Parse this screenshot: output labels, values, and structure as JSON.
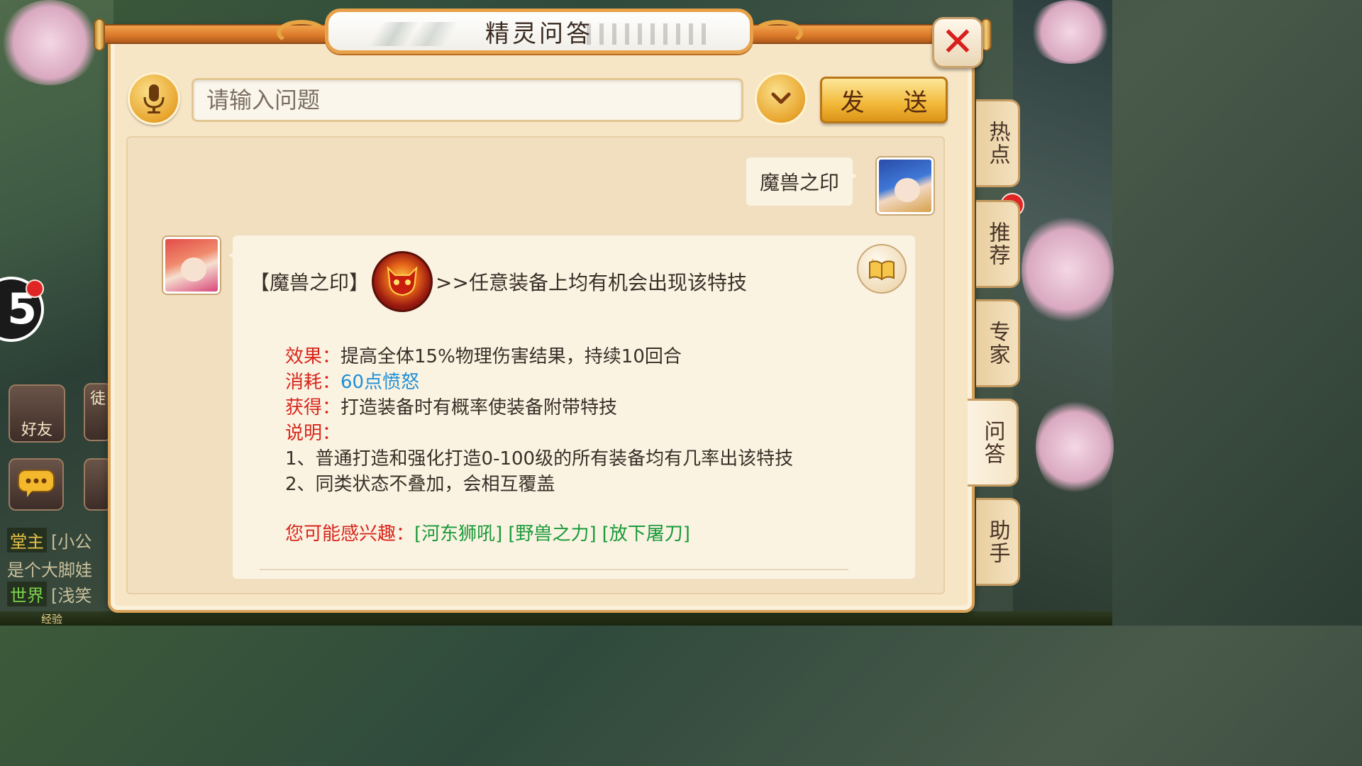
{
  "dialog": {
    "title": "精灵问答"
  },
  "input": {
    "placeholder": "请输入问题"
  },
  "buttons": {
    "send": "发 送"
  },
  "tabs": [
    {
      "label": "热点",
      "has_badge": true
    },
    {
      "label": "推荐"
    },
    {
      "label": "专家"
    },
    {
      "label": "问答",
      "active": true
    },
    {
      "label": "助手"
    }
  ],
  "conversation": {
    "user_message": "魔兽之印",
    "answer": {
      "skill_name": "【魔兽之印】",
      "skill_summary": ">>任意装备上均有机会出现该特技",
      "effect_label": "效果：",
      "effect_value": "提高全体15%物理伤害结果，持续10回合",
      "cost_label": "消耗：",
      "cost_value": "60点愤怒",
      "obtain_label": "获得：",
      "obtain_value": "打造装备时有概率使装备附带特技",
      "note_label": "说明：",
      "note_lines": [
        "1、普通打造和强化打造0-100级的所有装备均有几率出该特技",
        "2、同类状态不叠加，会相互覆盖"
      ],
      "interest_label": "您可能感兴趣：",
      "interest_links": [
        "[河东狮吼]",
        "[野兽之力]",
        "[放下屠刀]"
      ]
    }
  },
  "background_hud": {
    "friends_label": "好友",
    "apprentice_label": "徒",
    "chat_lines": [
      {
        "channel": "堂主",
        "text": "[小公"
      },
      {
        "channel": "",
        "text": "是个大脚娃"
      },
      {
        "channel": "世界",
        "text": "[浅笑"
      }
    ],
    "exp_label": "经验",
    "round_number": "5"
  },
  "colors": {
    "accent_red": "#d8261c",
    "link_green": "#1a9a3a",
    "value_blue": "#1f8fd6",
    "panel_bg": "#f7e6c6",
    "gold": "#e8a52e"
  }
}
